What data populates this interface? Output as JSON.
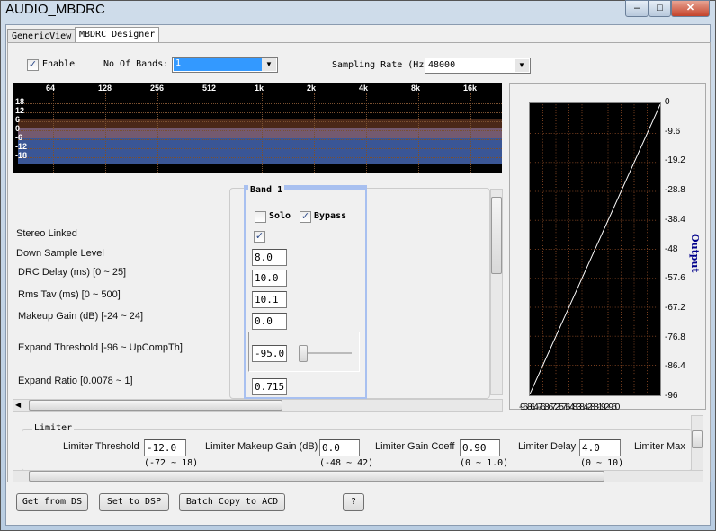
{
  "window": {
    "title": "AUDIO_MBDRC",
    "minimize": "‒",
    "maximize": "□",
    "close": "✕"
  },
  "tabs": [
    {
      "label": "GenericView",
      "active": false
    },
    {
      "label": "MBDRC Designer",
      "active": true
    }
  ],
  "top": {
    "enable_label": "Enable",
    "enable_checked": true,
    "bands_label": "No Of Bands:",
    "bands_value": "1",
    "sampling_label": "Sampling Rate (Hz)",
    "sampling_value": "48000"
  },
  "spectrum": {
    "x_ticks": [
      "64",
      "128",
      "256",
      "512",
      "1k",
      "2k",
      "4k",
      "8k",
      "16k"
    ],
    "y_ticks": [
      "18",
      "12",
      "6",
      "0",
      "-6",
      "-12",
      "-18"
    ]
  },
  "band": {
    "title": "Band 1",
    "solo_label": "Solo",
    "solo_checked": false,
    "bypass_label": "Bypass",
    "bypass_checked": true,
    "stereo_linked_checked": true,
    "down_sample": "8.0",
    "drc_delay": "10.0",
    "rms_tav": "10.1",
    "makeup_gain": "0.0",
    "expand_threshold": "-95.0",
    "expand_ratio": "0.715"
  },
  "labels": {
    "stereo": "Stereo Linked",
    "down": "Down Sample Level",
    "delay": "DRC Delay (ms)  [0 ~ 25]",
    "rms": "Rms Tav (ms)  [0 ~ 500]",
    "makeup": "Makeup Gain (dB)  [-24 ~ 24]",
    "exp_th": "Expand Threshold  [-96 ~ UpCompTh]",
    "exp_ratio": "Expand Ratio  [0.0078 ~ 1]"
  },
  "transfer": {
    "ylabel": "Output",
    "y_ticks": [
      "0",
      "-9.6",
      "-19.2",
      "-28.8",
      "-38.4",
      "-48",
      "-57.6",
      "-67.2",
      "-76.8",
      "-86.4",
      "-96"
    ],
    "x_ticks": [
      "-96",
      "-86.4",
      "-76.8",
      "-67.2",
      "-57.6",
      "-48",
      "-38.4",
      "-28.8",
      "-19.2",
      "-9.6",
      "0"
    ]
  },
  "limiter": {
    "title": "Limiter",
    "fields": [
      {
        "label": "Limiter Threshold",
        "value": "-12.0",
        "range": "(-72 ~ 18)"
      },
      {
        "label": "Limiter Makeup Gain (dB)",
        "value": "0.0",
        "range": "(-48 ~ 42)"
      },
      {
        "label": "Limiter Gain Coeff",
        "value": "0.90",
        "range": "(0 ~ 1.0)"
      },
      {
        "label": "Limiter Delay",
        "value": "4.0",
        "range": "(0 ~ 10)"
      },
      {
        "label": "Limiter Max",
        "value": "",
        "range": ""
      }
    ]
  },
  "buttons": {
    "get": "Get from DS",
    "set": "Set to DSP",
    "batch": "Batch Copy to ACD",
    "help": "?"
  }
}
